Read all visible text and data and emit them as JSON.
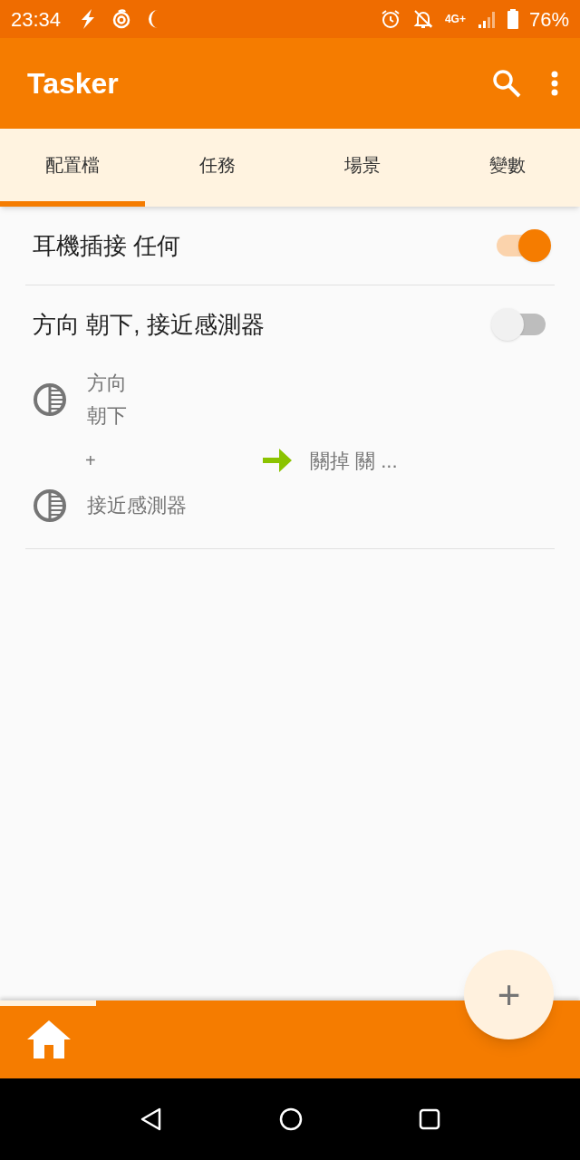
{
  "status_bar": {
    "time": "23:34",
    "network": "4G+",
    "battery": "76%"
  },
  "app_bar": {
    "title": "Tasker"
  },
  "tabs": [
    {
      "label": "配置檔",
      "selected": true
    },
    {
      "label": "任務",
      "selected": false
    },
    {
      "label": "場景",
      "selected": false
    },
    {
      "label": "變數",
      "selected": false
    }
  ],
  "profiles": [
    {
      "name": "耳機插接 任何",
      "on": true,
      "expanded": false
    },
    {
      "name": "方向 朝下, 接近感測器",
      "on": false,
      "expanded": true,
      "contexts": [
        {
          "lines": [
            "方向",
            "朝下"
          ]
        },
        {
          "lines": [
            "接近感測器"
          ]
        }
      ],
      "add": "+",
      "task": "關掉 關 ..."
    }
  ],
  "fab": {
    "label": "+"
  }
}
